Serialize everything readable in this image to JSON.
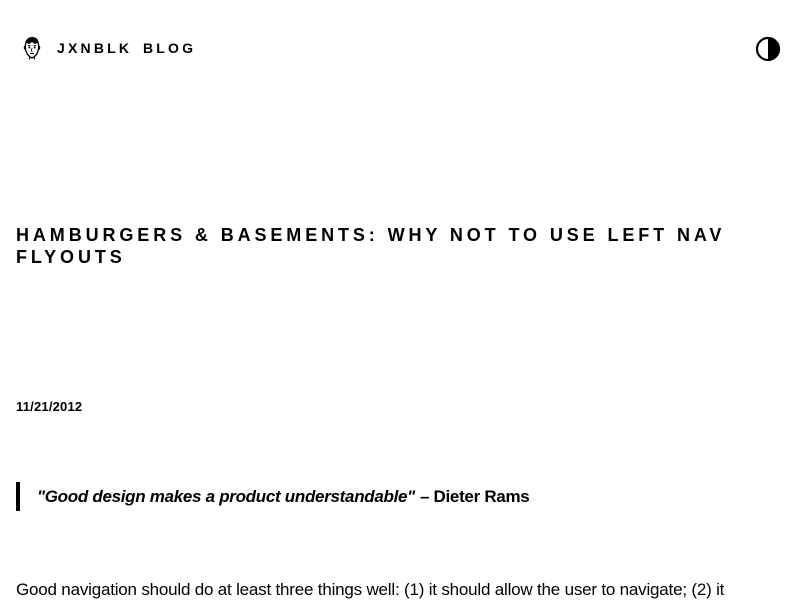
{
  "header": {
    "logo_icon": "face-avatar-icon",
    "brand": "JXNBLK",
    "nav_blog": "BLOG",
    "theme_toggle_icon": "contrast-half-circle-icon"
  },
  "post": {
    "title": "HAMBURGERS & BASEMENTS: WHY NOT TO USE LEFT NAV FLYOUTS",
    "date": "11/21/2012",
    "quote": {
      "text": "\"Good design makes a product understandable\"",
      "author": "– Dieter Rams"
    },
    "body_first_line": "Good navigation should do at least three things well: (1) it should allow the user to navigate; (2) it"
  },
  "colors": {
    "background": "#ffffff",
    "text": "#000000",
    "accent_border": "#000000"
  }
}
